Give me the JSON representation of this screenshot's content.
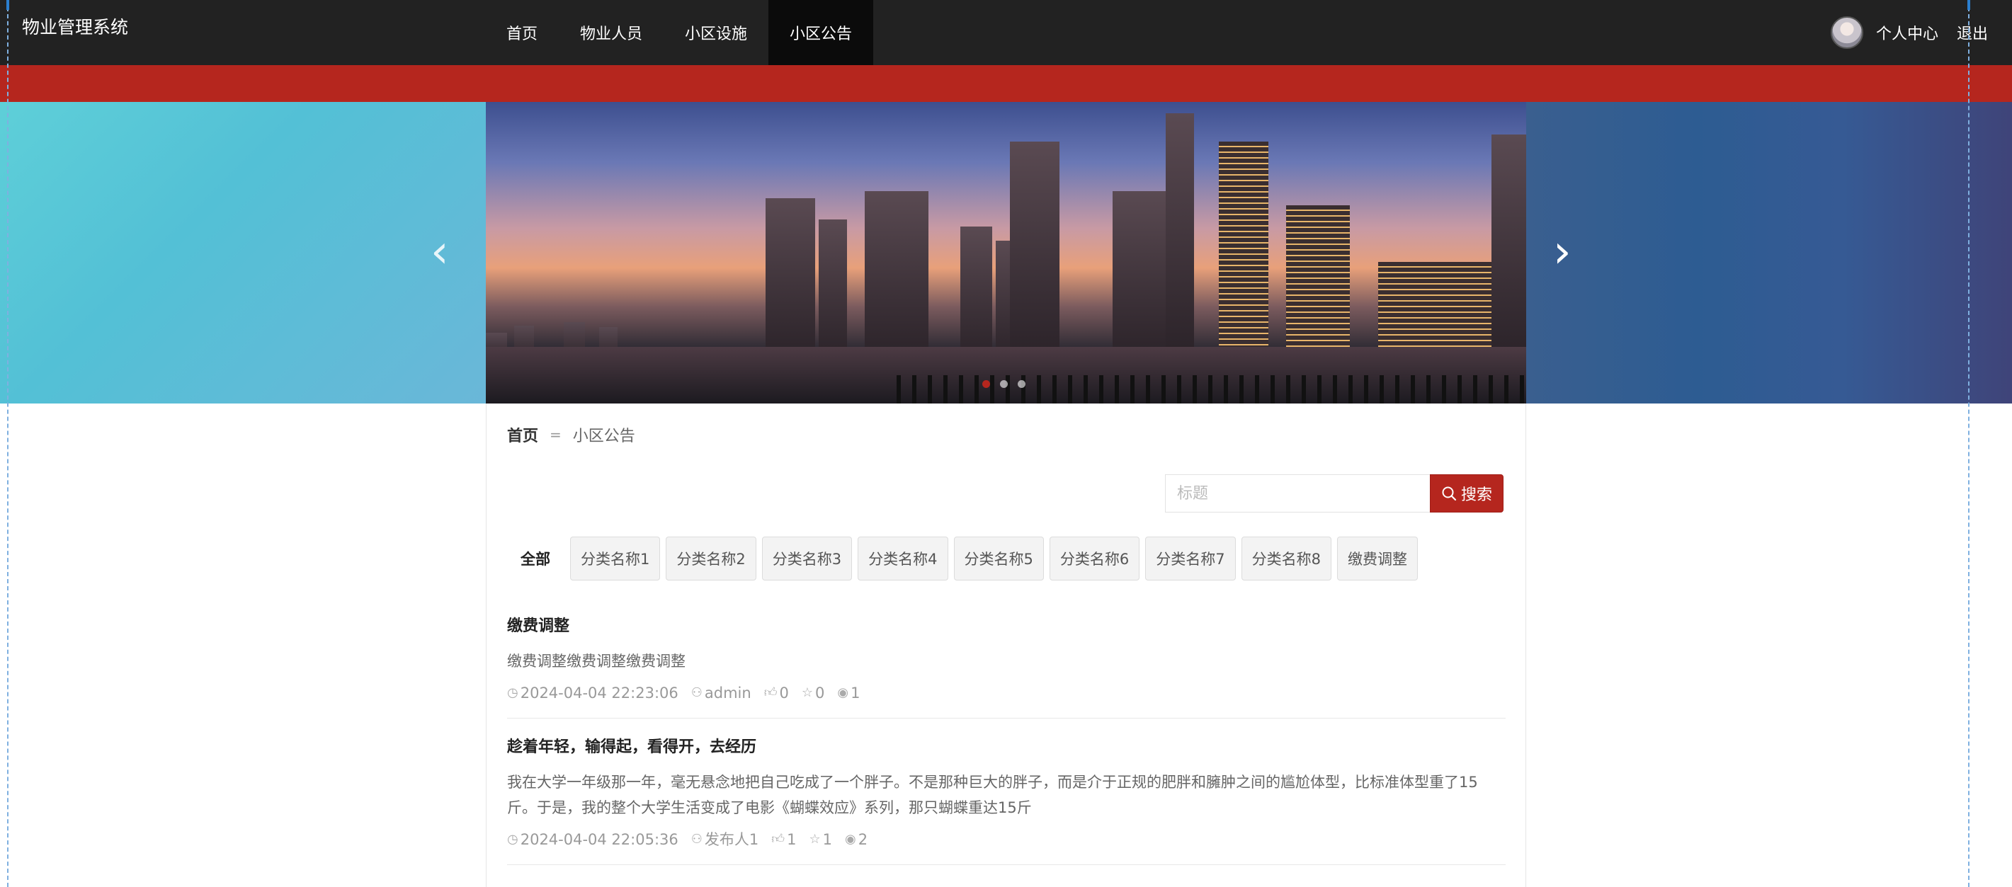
{
  "header": {
    "brand": "物业管理系统",
    "nav": [
      {
        "label": "首页"
      },
      {
        "label": "物业人员"
      },
      {
        "label": "小区设施"
      },
      {
        "label": "小区公告"
      }
    ],
    "active_nav": "小区公告",
    "user_center": "个人中心",
    "logout": "退出"
  },
  "banner": {
    "prev_icon": "chevron-left-icon",
    "next_icon": "chevron-right-icon",
    "slide_count": 3,
    "active_slide": 1
  },
  "breadcrumb": {
    "home": "首页",
    "separator": "=",
    "current": "小区公告"
  },
  "search": {
    "placeholder": "标题",
    "value": "",
    "button_label": "搜索",
    "button_icon": "search-icon"
  },
  "categories": {
    "all": "全部",
    "items": [
      "分类名称1",
      "分类名称2",
      "分类名称3",
      "分类名称4",
      "分类名称5",
      "分类名称6",
      "分类名称7",
      "分类名称8",
      "缴费调整"
    ]
  },
  "notices": [
    {
      "title": "缴费调整",
      "desc": "缴费调整缴费调整缴费调整",
      "time": "2024-04-04 22:23:06",
      "author": "admin",
      "likes": "0",
      "favorites": "0",
      "views": "1"
    },
    {
      "title": "趁着年轻，输得起，看得开，去经历",
      "desc": "我在大学一年级那一年，毫无悬念地把自己吃成了一个胖子。不是那种巨大的胖子，而是介于正规的肥胖和臃肿之间的尴尬体型，比标准体型重了15斤。于是，我的整个大学生活变成了电影《蝴蝶效应》系列，那只蝴蝶重达15斤",
      "time": "2024-04-04 22:05:36",
      "author": "发布人1",
      "likes": "1",
      "favorites": "1",
      "views": "2"
    }
  ],
  "colors": {
    "topbar": "#222222",
    "accent": "#b5261e"
  }
}
